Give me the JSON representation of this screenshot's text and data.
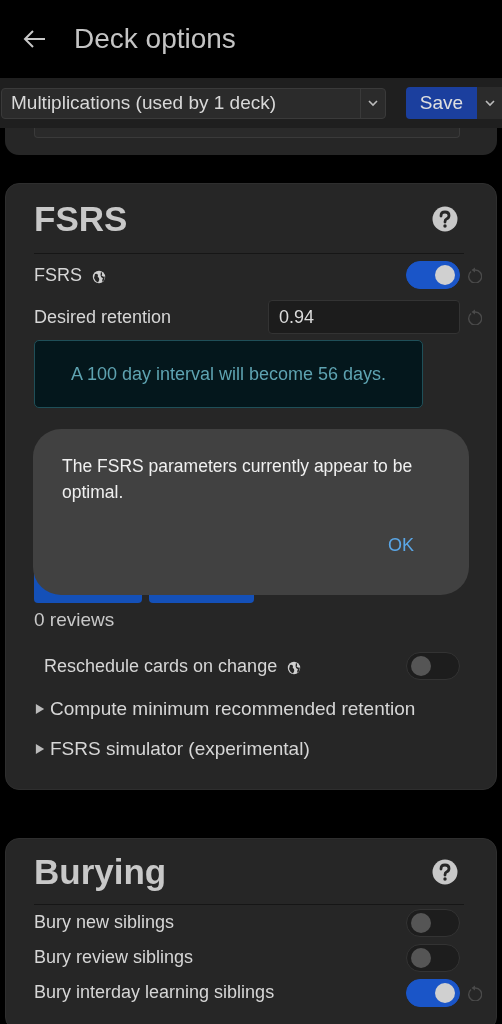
{
  "header": {
    "title": "Deck options"
  },
  "toolbar": {
    "preset": "Multiplications (used by 1 deck)",
    "save_label": "Save"
  },
  "sections": [
    {
      "title": "FSRS",
      "rows": [
        {
          "kind": "toggle",
          "label": "FSRS",
          "globe": true,
          "on": true,
          "reset": true
        },
        {
          "kind": "number",
          "label": "Desired retention",
          "globe": false,
          "value": "0.94",
          "reset": true
        },
        {
          "kind": "info",
          "text": "A 100 day interval will become 56 days."
        },
        {
          "kind": "covered"
        },
        {
          "kind": "note",
          "text": "0 reviews"
        },
        {
          "kind": "inset_toggle",
          "label": "Reschedule cards on change",
          "globe": true,
          "on": false,
          "reset": false
        },
        {
          "kind": "details",
          "label": "Compute minimum recommended retention",
          "expanded": false
        },
        {
          "kind": "details",
          "label": "FSRS simulator (experimental)",
          "expanded": false
        }
      ]
    },
    {
      "title": "Burying",
      "rows": [
        {
          "kind": "toggle",
          "label": "Bury new siblings",
          "globe": false,
          "on": false,
          "reset": false
        },
        {
          "kind": "toggle",
          "label": "Bury review siblings",
          "globe": false,
          "on": false,
          "reset": false
        },
        {
          "kind": "toggle",
          "label": "Bury interday learning siblings",
          "globe": false,
          "on": true,
          "reset": true
        }
      ]
    }
  ],
  "dialog": {
    "message": "The FSRS parameters currently appear to be optimal.",
    "button": "OK"
  }
}
